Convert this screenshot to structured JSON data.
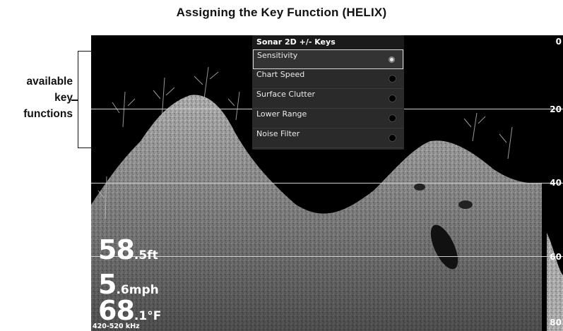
{
  "page": {
    "title": "Assigning the Key Function (HELIX)"
  },
  "callout": {
    "line1": "available",
    "line2": "key",
    "line3": "functions"
  },
  "menu": {
    "title": "Sonar 2D +/- Keys",
    "items": [
      {
        "label": "Sensitivity",
        "selected": true
      },
      {
        "label": "Chart Speed",
        "selected": false
      },
      {
        "label": "Surface Clutter",
        "selected": false
      },
      {
        "label": "Lower Range",
        "selected": false
      },
      {
        "label": "Noise Filter",
        "selected": false
      }
    ]
  },
  "depth_scale": [
    "0",
    "20",
    "40",
    "60",
    "80"
  ],
  "readouts": {
    "depth": {
      "value": "58",
      "decimal": ".5",
      "unit": "ft"
    },
    "speed": {
      "value": "5",
      "decimal": ".6",
      "unit": "mph"
    },
    "temp": {
      "value": "68",
      "decimal": ".1",
      "unit": "°F"
    }
  },
  "frequency": "420-520 kHz"
}
